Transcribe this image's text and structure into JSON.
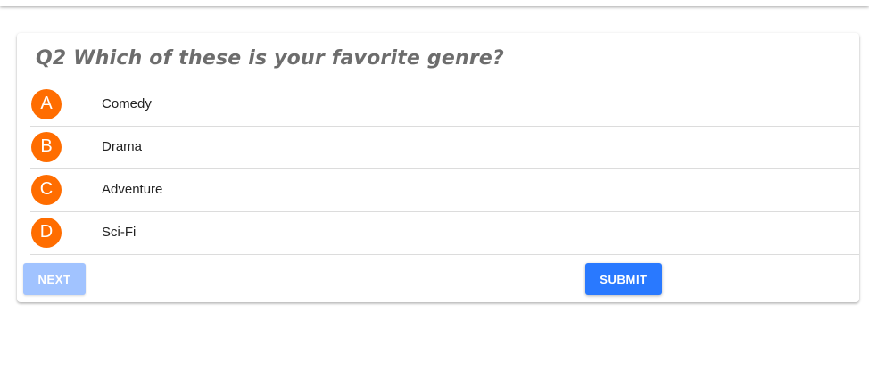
{
  "quiz": {
    "question": "Q2 Which of these is your favorite genre?",
    "options": [
      {
        "letter": "A",
        "label": "Comedy"
      },
      {
        "letter": "B",
        "label": "Drama"
      },
      {
        "letter": "C",
        "label": "Adventure"
      },
      {
        "letter": "D",
        "label": "Sci-Fi"
      }
    ],
    "next_label": "NEXT",
    "submit_label": "SUBMIT"
  },
  "colors": {
    "badge": "#ff6d00",
    "submit": "#2979ff",
    "next_disabled": "#a1c3ff",
    "question_text": "#6d6d6d"
  }
}
